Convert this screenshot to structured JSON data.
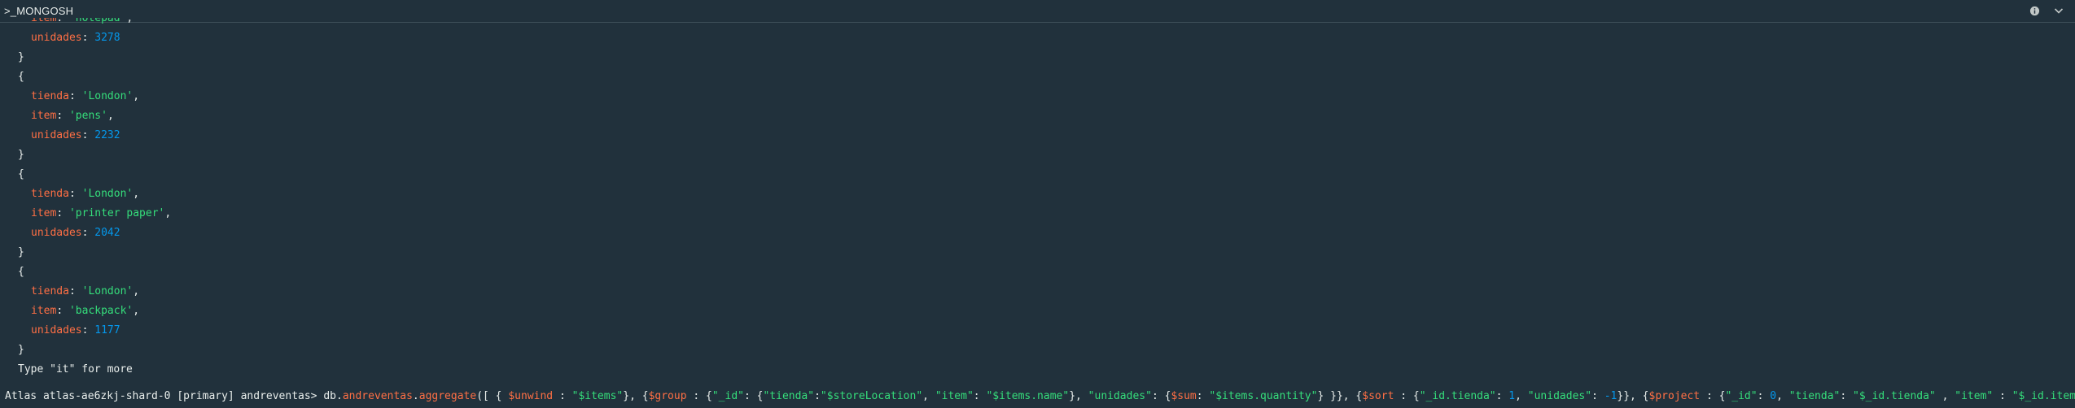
{
  "header": {
    "title": ">_MONGOSH"
  },
  "output": {
    "top_item": {
      "key": "item",
      "value": "'notepad'"
    },
    "top_unidades": {
      "key": "unidades",
      "value": "3278"
    },
    "docs": [
      {
        "tienda": "'London'",
        "item": "'pens'",
        "unidades": "2232"
      },
      {
        "tienda": "'London'",
        "item": "'printer paper'",
        "unidades": "2042"
      },
      {
        "tienda": "'London'",
        "item": "'backpack'",
        "unidades": "1177"
      }
    ],
    "keys": {
      "tienda": "tienda",
      "item": "item",
      "unidades": "unidades"
    },
    "more_hint": "Type \"it\" for more"
  },
  "prompt": {
    "prefix": "Atlas atlas-ae6zkj-shard-0 [primary] andreventas> ",
    "db": "db.",
    "collection": "andreventas",
    "dot": ".",
    "method": "aggregate",
    "open": "([ { ",
    "unwind": "$unwind",
    "sep1": " : ",
    "unwind_val": "\"$items\"",
    "p1": "}, {",
    "group": "$group",
    "sep2": " : {",
    "id_key": "\"_id\"",
    "p2": ": {",
    "tienda_key": "\"tienda\"",
    "p3": ":",
    "store_val": "\"$storeLocation\"",
    "p4": ", ",
    "item_key": "\"item\"",
    "p5": ": ",
    "name_val": "\"$items.name\"",
    "p6": "}, ",
    "unidades_key": "\"unidades\"",
    "p7": ": {",
    "sum": "$sum",
    "p8": ": ",
    "qty_val": "\"$items.quantity\"",
    "p9": "} }}, {",
    "sort": "$sort",
    "p10": " : {",
    "sort_key1": "\"_id.tienda\"",
    "p11": ": ",
    "one": "1",
    "p12": ", ",
    "sort_key2": "\"unidades\"",
    "p13": ": ",
    "minus_one": "-1",
    "p14": "}}, {",
    "project": "$project",
    "p15": " : {",
    "proj_id": "\"_id\"",
    "p16": ": ",
    "zero": "0",
    "p17": ", ",
    "proj_tienda": "\"tienda\"",
    "p18": ": ",
    "proj_tienda_val": "\"$_id.tienda\"",
    "p19": " , ",
    "proj_item": "\"item\"",
    "p20": " : ",
    "proj_item_val": "\"$_id.item"
  }
}
